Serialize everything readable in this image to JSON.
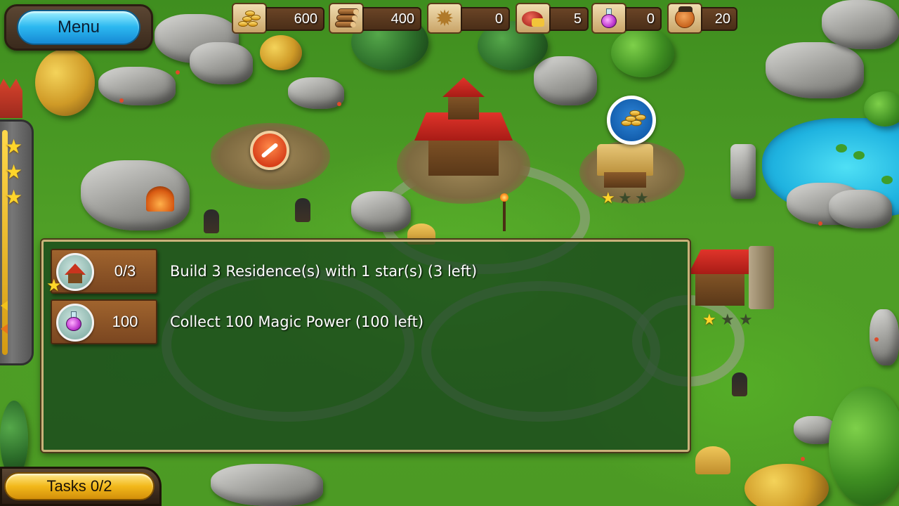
{
  "header": {
    "menu_label": "Menu"
  },
  "resources": [
    {
      "name": "gold",
      "icon": "gold-coins-icon",
      "value": "600"
    },
    {
      "name": "wood",
      "icon": "wood-logs-icon",
      "value": "400"
    },
    {
      "name": "stone",
      "icon": "stone-icon",
      "value": "0"
    },
    {
      "name": "food",
      "icon": "food-icon",
      "value": "5"
    },
    {
      "name": "magic",
      "icon": "potion-icon",
      "value": "0"
    },
    {
      "name": "workers",
      "icon": "worker-face-icon",
      "value": "20"
    }
  ],
  "tasks": [
    {
      "icon": "residence-icon",
      "count": "0/3",
      "text": "Build 3 Residence(s) with 1 star(s) (3 left)"
    },
    {
      "icon": "potion-icon",
      "count": "100",
      "text": "Collect 100 Magic Power (100 left)"
    }
  ],
  "footer": {
    "tasks_label": "Tasks 0/2"
  },
  "rating": {
    "stars_earned": 3
  },
  "colors": {
    "menu_blue": "#2cb8f0",
    "tasks_gold": "#f2b81a",
    "panel_bg": "#143e1c",
    "panel_border": "#c9b27a"
  }
}
